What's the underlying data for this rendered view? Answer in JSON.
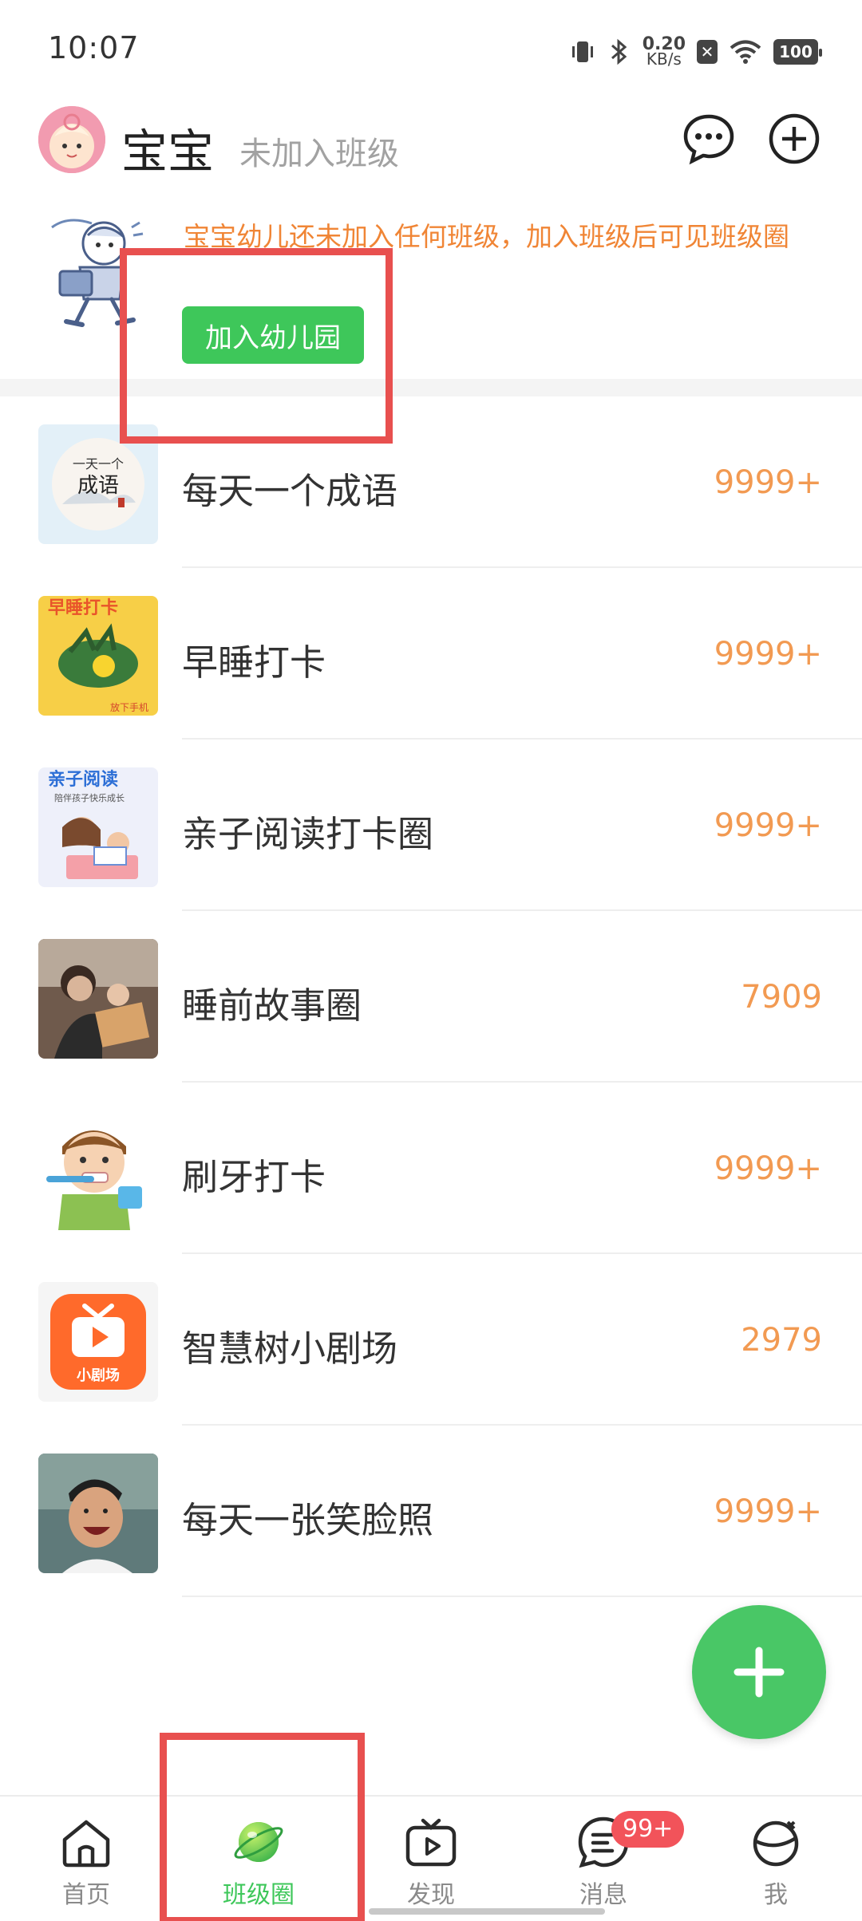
{
  "status_bar": {
    "time": "10:07",
    "net_speed_value": "0.20",
    "net_speed_unit": "KB/s",
    "battery": "100"
  },
  "header": {
    "baby_name": "宝宝",
    "class_status": "未加入班级"
  },
  "notice": {
    "text": "宝宝幼儿还未加入任何班级，加入班级后可见班级圈",
    "join_button": "加入幼儿园"
  },
  "circles": [
    {
      "name": "每天一个成语",
      "count": "9999+",
      "thumb_text": "一天一个 成语"
    },
    {
      "name": "早睡打卡",
      "count": "9999+",
      "thumb_text": "早睡打卡",
      "thumb_sub": "放下手机"
    },
    {
      "name": "亲子阅读打卡圈",
      "count": "9999+",
      "thumb_text": "亲子阅读",
      "thumb_sub": "陪伴孩子快乐成长"
    },
    {
      "name": "睡前故事圈",
      "count": "7909"
    },
    {
      "name": "刷牙打卡",
      "count": "9999+"
    },
    {
      "name": "智慧树小剧场",
      "count": "2979",
      "thumb_text": "小剧场"
    },
    {
      "name": "每天一张笑脸照",
      "count": "9999+"
    }
  ],
  "tabs": [
    {
      "label": "首页",
      "icon": "home-icon"
    },
    {
      "label": "班级圈",
      "icon": "planet-icon",
      "active": true
    },
    {
      "label": "发现",
      "icon": "tv-play-icon"
    },
    {
      "label": "消息",
      "icon": "message-icon",
      "badge": "99+"
    },
    {
      "label": "我",
      "icon": "profile-icon"
    }
  ],
  "colors": {
    "accent_green": "#3ec75a",
    "notice_orange": "#f08535",
    "count_orange": "#f29a52",
    "annotation_red": "#e8504f"
  }
}
